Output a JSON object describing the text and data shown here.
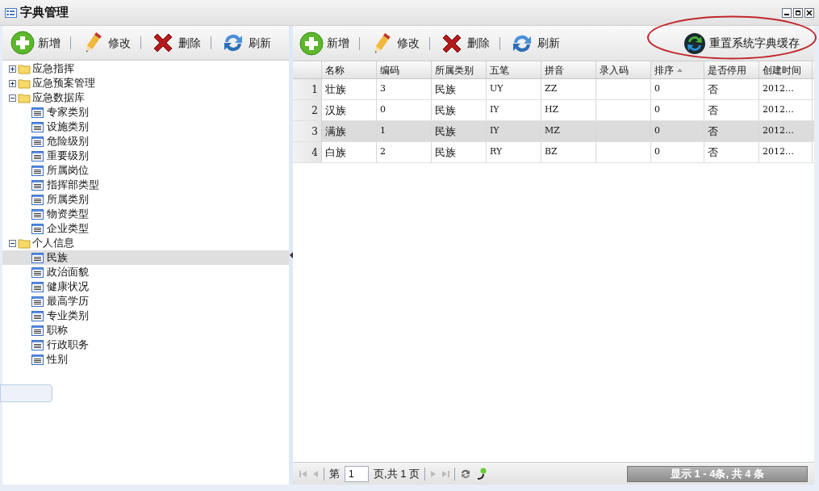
{
  "window": {
    "title": "字典管理"
  },
  "left_toolbar": [
    {
      "kind": "add",
      "label": "新增"
    },
    {
      "kind": "edit",
      "label": "修改"
    },
    {
      "kind": "delete",
      "label": "删除"
    },
    {
      "kind": "refresh",
      "label": "刷新"
    }
  ],
  "tree": [
    {
      "label": "应急指挥",
      "kind": "folder",
      "expanded": false,
      "selected": false
    },
    {
      "label": "应急预案管理",
      "kind": "folder",
      "expanded": false,
      "selected": false
    },
    {
      "label": "应急数据库",
      "kind": "folder",
      "expanded": true,
      "selected": false,
      "children": [
        {
          "label": "专家类别",
          "kind": "leaf",
          "selected": false
        },
        {
          "label": "设施类别",
          "kind": "leaf",
          "selected": false
        },
        {
          "label": "危险级别",
          "kind": "leaf",
          "selected": false
        },
        {
          "label": "重要级别",
          "kind": "leaf",
          "selected": false
        },
        {
          "label": "所属岗位",
          "kind": "leaf",
          "selected": false
        },
        {
          "label": "指挥部类型",
          "kind": "leaf",
          "selected": false
        },
        {
          "label": "所属类别",
          "kind": "leaf",
          "selected": false
        },
        {
          "label": "物资类型",
          "kind": "leaf",
          "selected": false
        },
        {
          "label": "企业类型",
          "kind": "leaf",
          "selected": false
        }
      ]
    },
    {
      "label": "个人信息",
      "kind": "folder",
      "expanded": true,
      "selected": false,
      "children": [
        {
          "label": "民族",
          "kind": "leaf",
          "selected": true
        },
        {
          "label": "政治面貌",
          "kind": "leaf",
          "selected": false
        },
        {
          "label": "健康状况",
          "kind": "leaf",
          "selected": false
        },
        {
          "label": "最高学历",
          "kind": "leaf",
          "selected": false
        },
        {
          "label": "专业类别",
          "kind": "leaf",
          "selected": false
        },
        {
          "label": "职称",
          "kind": "leaf",
          "selected": false
        },
        {
          "label": "行政职务",
          "kind": "leaf",
          "selected": false
        },
        {
          "label": "性别",
          "kind": "leaf",
          "selected": false
        }
      ]
    }
  ],
  "right_toolbar": [
    {
      "kind": "add",
      "label": "新增"
    },
    {
      "kind": "edit",
      "label": "修改"
    },
    {
      "kind": "delete",
      "label": "删除"
    },
    {
      "kind": "refresh",
      "label": "刷新"
    }
  ],
  "reset_button": {
    "label": "重置系统字典缓存"
  },
  "table": {
    "columns": [
      {
        "label": "名称",
        "sorted": false
      },
      {
        "label": "编码",
        "sorted": false
      },
      {
        "label": "所属类别",
        "sorted": false
      },
      {
        "label": "五笔",
        "sorted": false
      },
      {
        "label": "拼音",
        "sorted": false
      },
      {
        "label": "录入码",
        "sorted": false
      },
      {
        "label": "排序",
        "sorted": true
      },
      {
        "label": "是否停用",
        "sorted": false
      },
      {
        "label": "创建时间",
        "sorted": false
      }
    ],
    "rows": [
      {
        "number": "1",
        "selected": false,
        "cells": [
          "壮族",
          "3",
          "民族",
          "UY",
          "ZZ",
          "",
          "0",
          "否",
          "2012…"
        ]
      },
      {
        "number": "2",
        "selected": false,
        "cells": [
          "汉族",
          "0",
          "民族",
          "IY",
          "HZ",
          "",
          "0",
          "否",
          "2012…"
        ]
      },
      {
        "number": "3",
        "selected": true,
        "cells": [
          "满族",
          "1",
          "民族",
          "IY",
          "MZ",
          "",
          "0",
          "否",
          "2012…"
        ]
      },
      {
        "number": "4",
        "selected": false,
        "cells": [
          "白族",
          "2",
          "民族",
          "RY",
          "BZ",
          "",
          "0",
          "否",
          "2012…"
        ]
      }
    ]
  },
  "pager": {
    "page_prefix": "第",
    "page_value": "1",
    "page_suffix": "页,共 1 页",
    "info": "显示 1 - 4条, 共 4 条"
  }
}
